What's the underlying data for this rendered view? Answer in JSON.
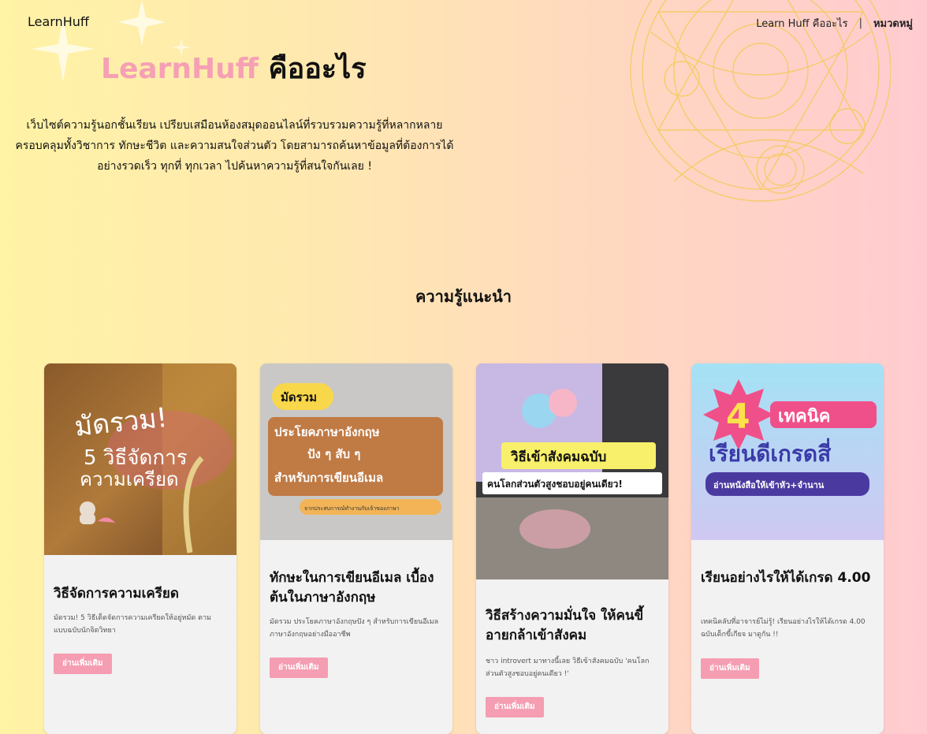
{
  "header": {
    "logo": "LearnHuff",
    "nav": [
      {
        "label": "Learn Huff คืออะไร"
      },
      {
        "label": "|"
      },
      {
        "label": "หมวดหมู่"
      }
    ]
  },
  "hero": {
    "title_brand": "LearnHuff",
    "title_rest": " คืออะไร",
    "description": "เว็บไซต์ความรู้นอกชั้นเรียน เปรียบเสมือนห้องสมุดออนไลน์ที่รวบรวมความรู้ที่หลากหลาย ครอบคลุมทั้งวิชาการ ทักษะชีวิต และความสนใจส่วนตัว โดยสามารถค้นหาข้อมูลที่ต้องการได้ อย่างรวดเร็ว ทุกที่ ทุกเวลา ไปค้นหาความรู้ที่สนใจกันเลย !"
  },
  "section": {
    "title": "ความรู้แนะนำ"
  },
  "cards": [
    {
      "title": "วิธีจัดการความเครียด",
      "desc": "มัดรวม! 5 วิธีเด็ดจัดการความเครียดให้อยู่หมัด ตามแบบฉบับนักจิตวิทยา",
      "button": "อ่านเพิ่มเติม",
      "image_text": [
        "มัดรวม!",
        "5 วิธีจัดการ",
        "ความเครียด"
      ]
    },
    {
      "title": "ทักษะในการเขียนอีเมล เบื้องต้นในภาษาอังกฤษ",
      "desc": "มัดรวม ประโยคภาษาอังกฤษปัง ๆ สำหรับการเขียนอีเมลภาษาอังกฤษอย่างมืออาชีพ",
      "button": "อ่านเพิ่มเติม",
      "image_text": [
        "มัดรวม",
        "ประโยคภาษาอังกฤษ",
        "ปัง ๆ สับ ๆ",
        "สำหรับการเขียนอีเมล",
        "จากประสบการณ์ทำงานกับเจ้าของภาษา"
      ]
    },
    {
      "title": "วิธีสร้างความมั่นใจ ให้คนขี้อายกล้าเข้าสังคม",
      "desc": "ชาว introvert มาทางนี้เลย วิธีเข้าสังคมฉบับ 'คนโลกส่วนตัวสูงชอบอยู่คนเดียว !'",
      "button": "อ่านเพิ่มเติม",
      "image_text": [
        "วิธีเข้าสังคมฉบับ",
        "คนโลกส่วนตัวสูงชอบอยู่คนเดียว!"
      ]
    },
    {
      "title": "เรียนอย่างไรให้ได้เกรด 4.00",
      "desc": "เทคนิคลับที่อาจารย์ไม่รู้! เรียนอย่างไรให้ได้เกรด 4.00 ฉบับเด็กขี้เกียจ มาดูกัน !!",
      "button": "อ่านเพิ่มเติม",
      "image_text": [
        "4",
        "เทคนิค",
        "เรียนดีเกรดสี่",
        "อ่านหนังสือให้เข้าหัว+จำนาน"
      ]
    }
  ]
}
